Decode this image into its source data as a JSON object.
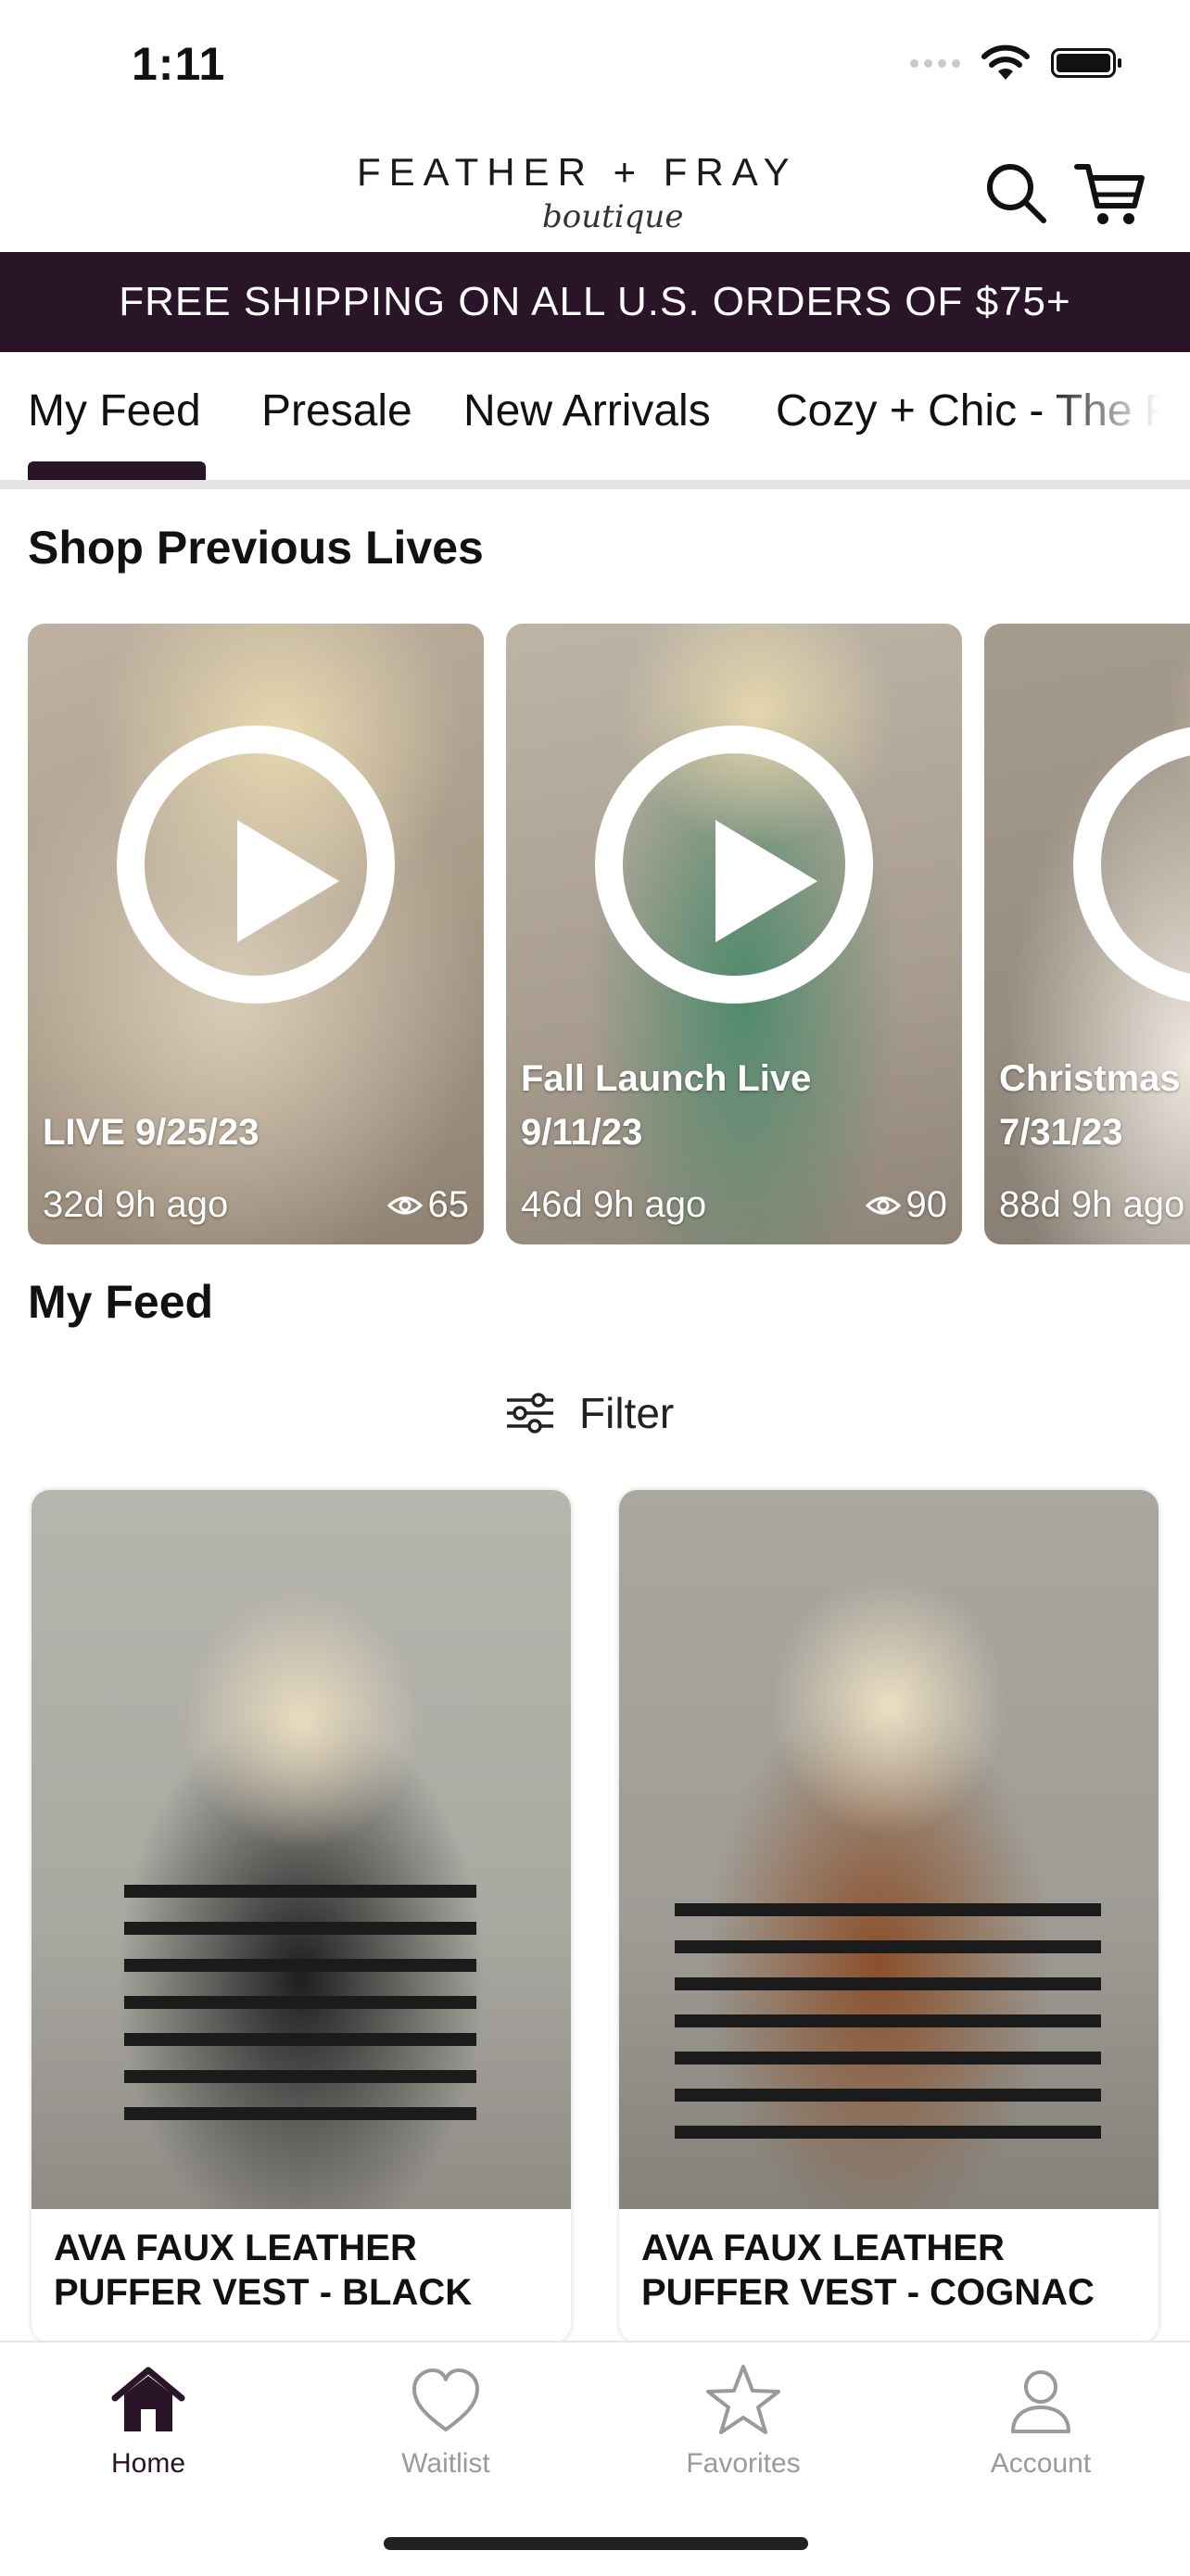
{
  "status_bar": {
    "time": "1:11"
  },
  "header": {
    "brand": "FEATHER + FRAY",
    "brand_sub": "boutique",
    "icons": [
      "search-icon",
      "cart-icon"
    ]
  },
  "promo_banner": "FREE SHIPPING ON ALL U.S. ORDERS OF $75+",
  "tabs": [
    {
      "label": "My Feed",
      "active": true
    },
    {
      "label": "Presale"
    },
    {
      "label": "New Arrivals"
    },
    {
      "label": "Cozy + Chic - The Fall"
    }
  ],
  "previous_lives": {
    "title": "Shop Previous Lives",
    "items": [
      {
        "line1": "LIVE 9/25/23",
        "line2": "",
        "ago": "32d 9h ago",
        "views": "65"
      },
      {
        "line1": "Fall Launch Live",
        "line2": "9/11/23",
        "ago": "46d 9h ago",
        "views": "90"
      },
      {
        "line1": "Christmas",
        "line2": "7/31/23",
        "ago": "88d 9h ago",
        "views": ""
      }
    ]
  },
  "feed": {
    "title": "My Feed",
    "filter_label": "Filter",
    "products": [
      {
        "name": "AVA FAUX LEATHER PUFFER VEST - BLACK"
      },
      {
        "name": "AVA FAUX LEATHER PUFFER VEST - COGNAC"
      }
    ]
  },
  "bottom_nav": [
    {
      "label": "Home",
      "icon": "home-icon",
      "active": true
    },
    {
      "label": "Waitlist",
      "icon": "heart-icon"
    },
    {
      "label": "Favorites",
      "icon": "star-icon"
    },
    {
      "label": "Account",
      "icon": "person-icon"
    }
  ],
  "colors": {
    "brand": "#2a1428",
    "inactive": "#9a9a9a",
    "tab_underline": "#e4e4e4"
  }
}
